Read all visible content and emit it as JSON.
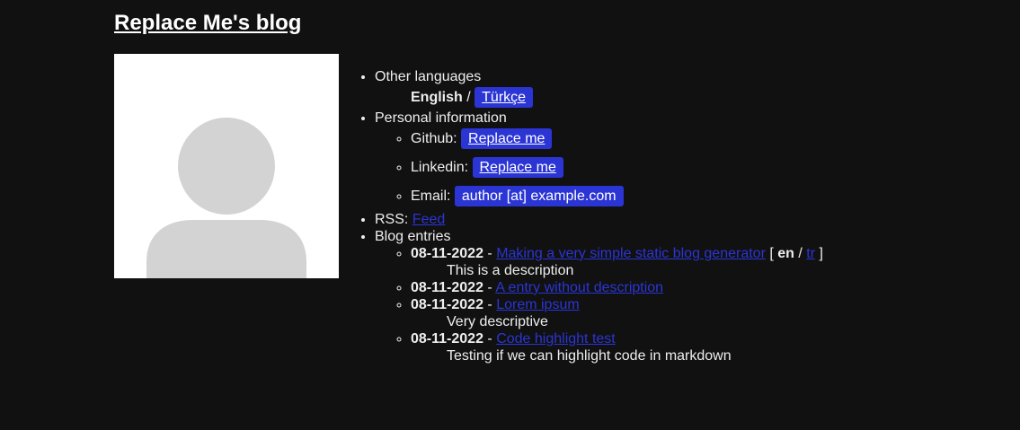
{
  "header": {
    "title": "Replace Me's blog"
  },
  "avatar": {
    "icon": "person-icon",
    "bg": "#ffffff",
    "fg": "#d3d3d3"
  },
  "languages": {
    "label": "Other languages",
    "current": "English",
    "separator": "/",
    "other": "Türkçe"
  },
  "personal": {
    "label": "Personal information",
    "github_label": "Github:",
    "github_link": "Replace me",
    "linkedin_label": "Linkedin:",
    "linkedin_link": "Replace me",
    "email_label": "Email:",
    "email_value": "author [at] example.com"
  },
  "rss": {
    "label": "RSS:",
    "link": "Feed"
  },
  "blog": {
    "label": "Blog entries",
    "entries": [
      {
        "date": "08-11-2022",
        "dash": "-",
        "title": "Making a very simple static blog generator",
        "lang_open": "[",
        "lang_current": "en",
        "lang_sep": "/",
        "lang_other": "tr",
        "lang_close": "]",
        "description": "This is a description"
      },
      {
        "date": "08-11-2022",
        "dash": "-",
        "title": "A entry without description"
      },
      {
        "date": "08-11-2022",
        "dash": "-",
        "title": "Lorem ipsum",
        "description": "Very descriptive"
      },
      {
        "date": "08-11-2022",
        "dash": "-",
        "title": "Code highlight test",
        "description": "Testing if we can highlight code in markdown"
      }
    ]
  },
  "colors": {
    "background": "#111111",
    "accent": "#2b35d4",
    "text": "#eeeeee"
  }
}
